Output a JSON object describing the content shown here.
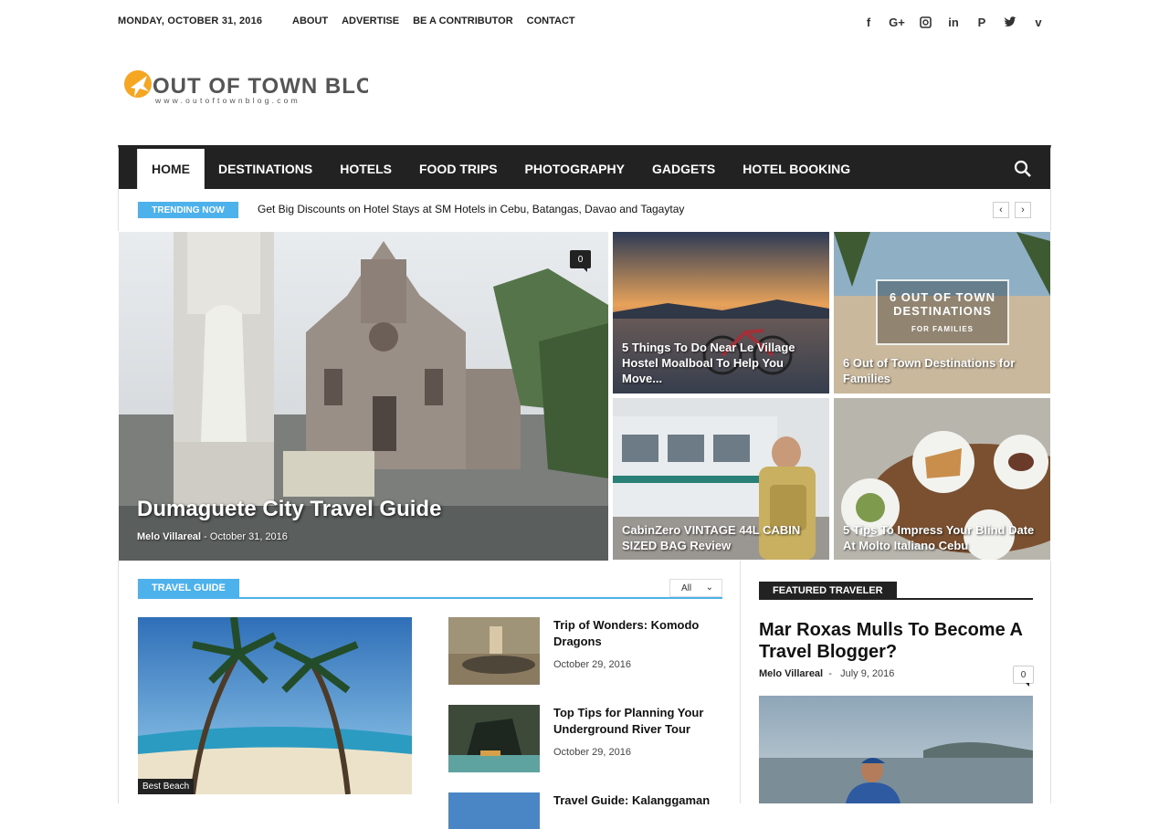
{
  "topbar": {
    "date": "MONDAY, OCTOBER 31, 2016",
    "links": [
      "ABOUT",
      "ADVERTISE",
      "BE A CONTRIBUTOR",
      "CONTACT"
    ],
    "social_icons": [
      "facebook-icon",
      "google-plus-icon",
      "instagram-icon",
      "linkedin-icon",
      "pinterest-icon",
      "twitter-icon",
      "vimeo-icon"
    ]
  },
  "logo": {
    "name": "OUT OF TOWN BLOG",
    "url_text": "www.outoftownblog.com",
    "accent": "#f5a623"
  },
  "nav": {
    "items": [
      "HOME",
      "DESTINATIONS",
      "HOTELS",
      "FOOD TRIPS",
      "PHOTOGRAPHY",
      "GADGETS",
      "HOTEL BOOKING"
    ],
    "active": "HOME"
  },
  "trending": {
    "tag": "TRENDING NOW",
    "headline": "Get Big Discounts on Hotel Stays at SM Hotels in Cebu, Batangas, Davao and Tagaytay"
  },
  "featured": {
    "main": {
      "title": "Dumaguete City Travel Guide",
      "author": "Melo Villareal",
      "date": "October 31, 2016",
      "comments": "0"
    },
    "tiles": [
      {
        "title": "5 Things To Do Near Le Village Hostel Moalboal To Help You Move..."
      },
      {
        "title": "6 Out of Town Destinations for Families",
        "image_text": [
          "6 OUT OF TOWN",
          "DESTINATIONS",
          "FOR FAMILIES"
        ]
      },
      {
        "title": "CabinZero VINTAGE 44L CABIN SIZED BAG Review"
      },
      {
        "title": "5 Tips To Impress Your Blind Date At Molto Italiano Cebu"
      }
    ]
  },
  "travel_guide": {
    "tag": "TRAVEL GUIDE",
    "filter": "All",
    "big_post_category": "Best Beach",
    "posts": [
      {
        "title": "Trip of Wonders: Komodo Dragons",
        "date": "October 29, 2016"
      },
      {
        "title": "Top Tips for Planning Your Underground River Tour",
        "date": "October 29, 2016"
      },
      {
        "title": "Travel Guide: Kalanggaman",
        "date": ""
      }
    ]
  },
  "featured_traveler": {
    "tag": "FEATURED TRAVELER",
    "title": "Mar Roxas Mulls To Become A Travel Blogger?",
    "author": "Melo Villareal",
    "date": "July 9, 2016",
    "comments": "0"
  },
  "colors": {
    "accent_blue": "#4db2ec",
    "nav_dark": "#222222"
  }
}
